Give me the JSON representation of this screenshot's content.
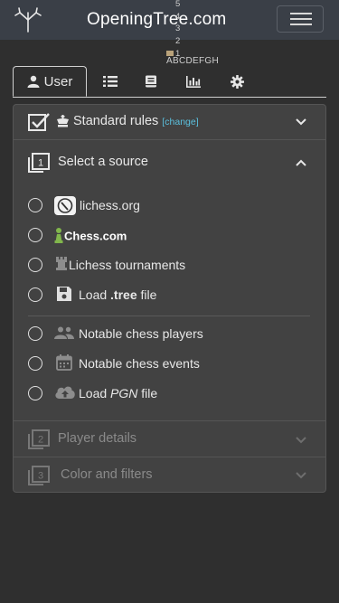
{
  "navbar": {
    "brand": "OpeningTree.com",
    "board_ranks": [
      "5",
      "4",
      "3",
      "2"
    ],
    "board_rank_1": "1",
    "board_files": "ABCDEFGH"
  },
  "tabs": [
    {
      "label": "User",
      "icon": "user-icon"
    },
    {
      "label": "",
      "icon": "list-icon"
    },
    {
      "label": "",
      "icon": "book-icon"
    },
    {
      "label": "",
      "icon": "chart-icon"
    },
    {
      "label": "",
      "icon": "gear-icon"
    }
  ],
  "rules": {
    "label": "Standard rules",
    "change": "[change]"
  },
  "source": {
    "header": "Select a source",
    "step": "1",
    "options": [
      {
        "label": "lichess.org",
        "icon": "lichess-icon"
      },
      {
        "label": "Chess.com",
        "icon": "chesscom-logo"
      },
      {
        "label": "Lichess tournaments",
        "icon": "rook-icon"
      },
      {
        "label_prefix": "Load ",
        "label_bold": ".tree",
        "label_suffix": " file",
        "icon": "save-icon"
      },
      {
        "label": "Notable chess players",
        "icon": "people-icon"
      },
      {
        "label": "Notable chess events",
        "icon": "calendar-icon"
      },
      {
        "label_prefix": "Load ",
        "label_italic": "PGN",
        "label_suffix": " file",
        "icon": "upload-icon"
      }
    ]
  },
  "steps": [
    {
      "number": "2",
      "label": "Player details"
    },
    {
      "number": "3",
      "label": "Color and filters"
    }
  ],
  "colors": {
    "background": "#2f2f2f",
    "navbar": "#3a3f47",
    "card": "#424242",
    "link": "#5bc0de"
  }
}
